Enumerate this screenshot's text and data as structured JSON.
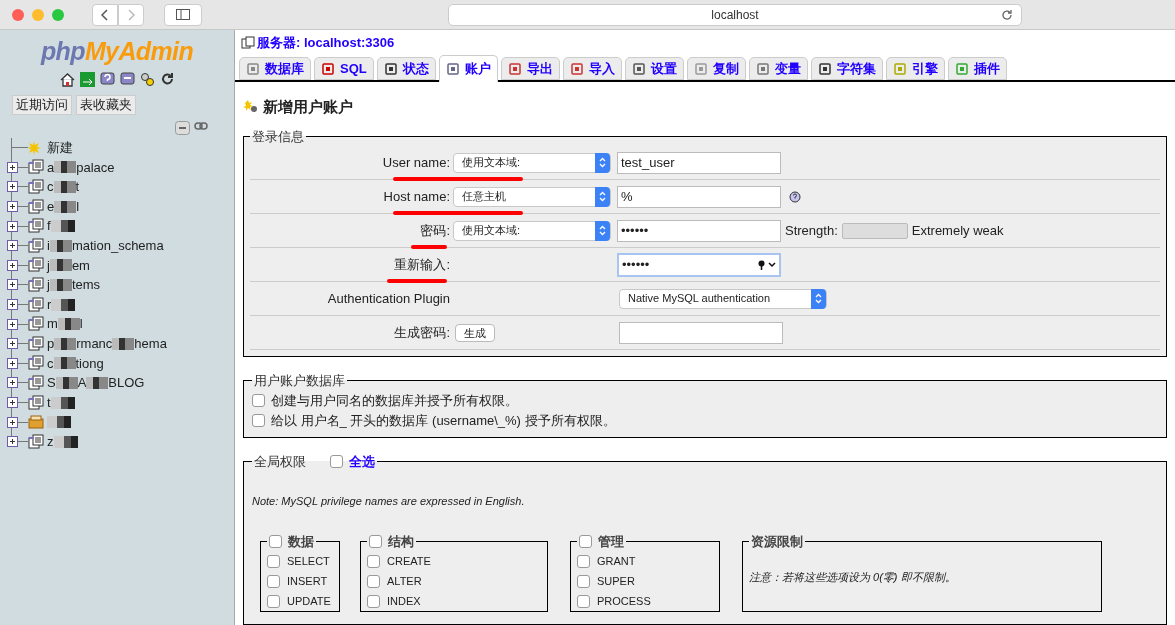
{
  "browser": {
    "address": "localhost"
  },
  "sidebar": {
    "logo_parts": [
      "php",
      "MyAdmin"
    ],
    "buttons": [
      "近期访问",
      "表收藏夹"
    ],
    "tree": [
      {
        "kind": "new",
        "parts": [
          "新建"
        ]
      },
      {
        "kind": "db",
        "parts": [
          "a",
          "palace"
        ]
      },
      {
        "kind": "db",
        "parts": [
          "c",
          "t"
        ]
      },
      {
        "kind": "db",
        "parts": [
          "e",
          "l"
        ]
      },
      {
        "kind": "db",
        "parts": [
          "f"
        ]
      },
      {
        "kind": "db",
        "parts": [
          "i",
          "mation_schema"
        ]
      },
      {
        "kind": "db",
        "parts": [
          "j",
          "em"
        ]
      },
      {
        "kind": "db",
        "parts": [
          "j",
          "tems"
        ]
      },
      {
        "kind": "db",
        "parts": [
          "r"
        ]
      },
      {
        "kind": "db",
        "parts": [
          "m",
          "l"
        ]
      },
      {
        "kind": "db",
        "parts": [
          "p",
          "rmanc",
          "hema"
        ]
      },
      {
        "kind": "db",
        "parts": [
          "c",
          "tiong"
        ]
      },
      {
        "kind": "db",
        "parts": [
          "S",
          "A",
          "BLOG"
        ]
      },
      {
        "kind": "db",
        "parts": [
          "t"
        ]
      },
      {
        "kind": "other"
      },
      {
        "kind": "db",
        "parts": [
          "z"
        ]
      }
    ]
  },
  "server": "服务器: localhost:3306",
  "tabs": [
    {
      "label": "数据库",
      "selected": false
    },
    {
      "label": "SQL",
      "selected": false
    },
    {
      "label": "状态",
      "selected": false
    },
    {
      "label": "账户",
      "selected": true
    },
    {
      "label": "导出",
      "selected": false
    },
    {
      "label": "导入",
      "selected": false
    },
    {
      "label": "设置",
      "selected": false
    },
    {
      "label": "复制",
      "selected": false
    },
    {
      "label": "变量",
      "selected": false
    },
    {
      "label": "字符集",
      "selected": false
    },
    {
      "label": "引擎",
      "selected": false
    },
    {
      "label": "插件",
      "selected": false
    }
  ],
  "page_title": "新增用户账户",
  "login": {
    "legend": "登录信息",
    "rows": [
      {
        "kind": "select_input",
        "label": "User name:",
        "underlined": true,
        "select": "使用文本域:",
        "value": "test_user"
      },
      {
        "kind": "select_input",
        "label": "Host name:",
        "underlined": true,
        "select": "任意主机",
        "value": "%",
        "help": true
      },
      {
        "kind": "password",
        "label": "密码:",
        "underlined": true,
        "select": "使用文本域:",
        "value": "••••••",
        "strength_label": "Strength:",
        "strength_text": "Extremely weak"
      },
      {
        "kind": "retype",
        "label": "重新输入:",
        "underlined": true,
        "value": "••••••"
      },
      {
        "kind": "plugin",
        "label": "Authentication Plugin",
        "underlined": false,
        "select": "Native MySQL authentication"
      },
      {
        "kind": "generate",
        "label": "生成密码:",
        "underlined": false,
        "button": "生成"
      }
    ]
  },
  "user_db": {
    "legend": "用户账户数据库",
    "options": [
      {
        "label": "创建与用户同名的数据库并授予所有权限。",
        "checked": false
      },
      {
        "label": "给以 用户名_ 开头的数据库 (username\\_%) 授予所有权限。",
        "checked": false
      }
    ]
  },
  "privileges": {
    "legend": "全局权限",
    "select_all": {
      "label": "全选",
      "checked": false
    },
    "note": "Note: MySQL privilege names are expressed in English.",
    "groups": [
      {
        "title": "数据",
        "checked": false,
        "items": [
          {
            "label": "SELECT",
            "checked": false
          },
          {
            "label": "INSERT",
            "checked": false
          },
          {
            "label": "UPDATE",
            "checked": false
          }
        ]
      },
      {
        "title": "结构",
        "checked": false,
        "items": [
          {
            "label": "CREATE",
            "checked": false
          },
          {
            "label": "ALTER",
            "checked": false
          },
          {
            "label": "INDEX",
            "checked": false
          }
        ]
      },
      {
        "title": "管理",
        "checked": false,
        "items": [
          {
            "label": "GRANT",
            "checked": false
          },
          {
            "label": "SUPER",
            "checked": false
          },
          {
            "label": "PROCESS",
            "checked": false
          }
        ]
      }
    ],
    "limits": {
      "title": "资源限制",
      "note": "注意：若将这些选项设为 0(零) 即不限制。"
    }
  }
}
